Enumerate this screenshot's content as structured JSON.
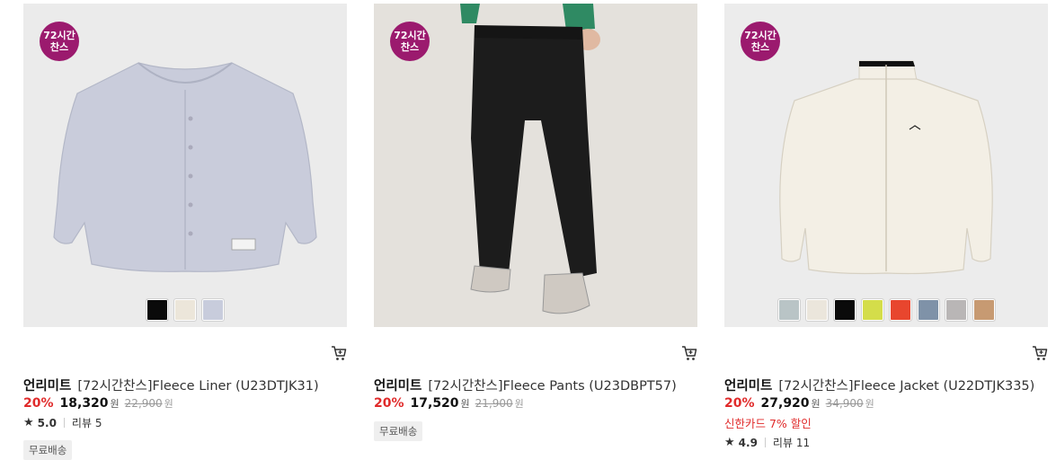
{
  "products": [
    {
      "badge_line1": "72시간",
      "badge_line2": "찬스",
      "brand": "언리미트",
      "name": "[72시간찬스]Fleece Liner (U23DTJK31)",
      "discount": "20%",
      "sale_price": "18,320",
      "currency": "원",
      "original_price": "22,900",
      "rating": "5.0",
      "reviews": "리뷰 5",
      "tag": "무료배송",
      "swatches": [
        "#0a0a0a",
        "#ece6da",
        "#c8ccdc"
      ]
    },
    {
      "badge_line1": "72시간",
      "badge_line2": "찬스",
      "brand": "언리미트",
      "name": "[72시간찬스]Fleece Pants (U23DBPT57)",
      "discount": "20%",
      "sale_price": "17,520",
      "currency": "원",
      "original_price": "21,900",
      "tag": "무료배송"
    },
    {
      "badge_line1": "72시간",
      "badge_line2": "찬스",
      "brand": "언리미트",
      "name": "[72시간찬스]Fleece Jacket (U22DTJK335)",
      "discount": "20%",
      "sale_price": "27,920",
      "currency": "원",
      "original_price": "34,900",
      "promo": "신한카드 7% 할인",
      "rating": "4.9",
      "reviews": "리뷰 11",
      "swatches": [
        "#b9c4c6",
        "#ebe6dc",
        "#0a0a0a",
        "#d4dd4a",
        "#e8462e",
        "#7f92a8",
        "#b9b6b6",
        "#c79a72"
      ]
    }
  ],
  "colors": {
    "badge": "#9b1a6e",
    "discount": "#e02b2b"
  },
  "icons": {
    "cart": "cart-icon",
    "star": "star-icon"
  }
}
